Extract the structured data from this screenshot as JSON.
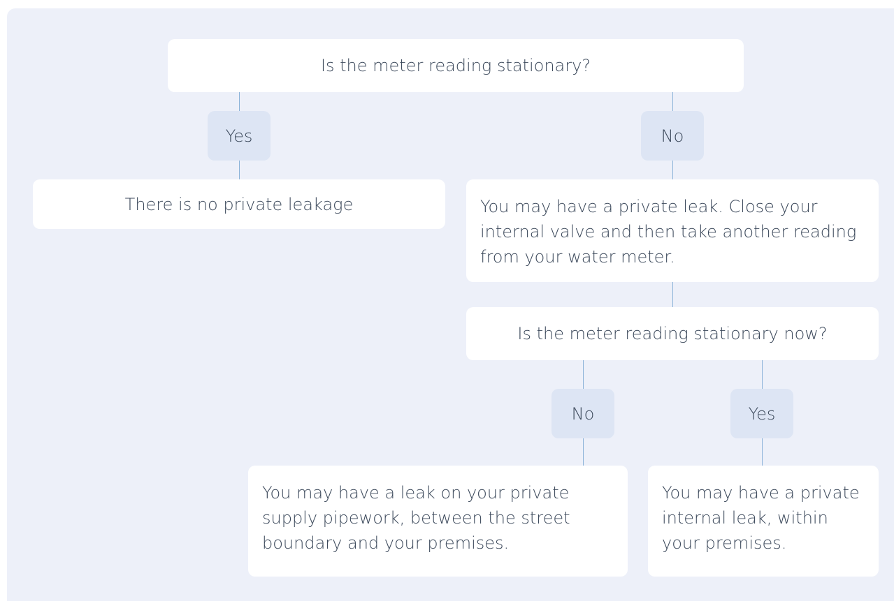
{
  "flow": {
    "q1": "Is the meter reading stationary?",
    "q1_yes": "Yes",
    "q1_no": "No",
    "no_leak": "There is no private leakage",
    "possible_leak": "You may have a private leak. Close your internal valve and then take another reading from your water meter.",
    "q2": "Is the meter reading stationary now?",
    "q2_no": "No",
    "q2_yes": "Yes",
    "supply_leak": "You may have a leak on your private supply pipework, between the street boundary and your premises.",
    "internal_leak": "You may have a private internal leak, within your premises."
  }
}
